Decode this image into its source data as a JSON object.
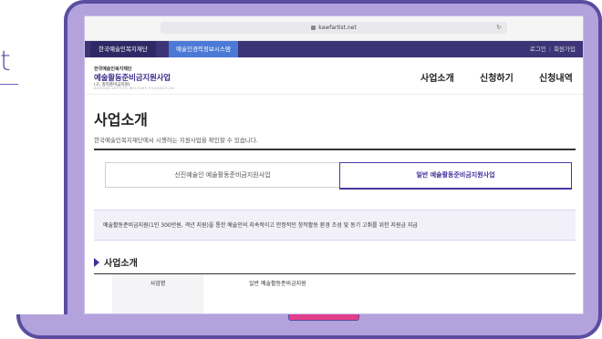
{
  "background": {
    "partial_text": "t"
  },
  "browser": {
    "url": "kawfartist.net"
  },
  "topbar": {
    "tab_foundation": "한국예술인복지재단",
    "tab_system": "예술인경력정보시스템",
    "login": "로그인",
    "separator": "|",
    "signup": "회원가입"
  },
  "header": {
    "logo_small": "한국예술인복지재단",
    "logo_main": "예술활동준비금지원사업",
    "logo_sub": "(구, 창작준비금지원)",
    "logo_en": "KOREAN ARTISTS WELFARE FOUNDATION",
    "nav": [
      "사업소개",
      "신청하기",
      "신청내역"
    ]
  },
  "page": {
    "title": "사업소개",
    "subtitle": "한국예술인복지재단에서 시행하는 지원사업을 확인할 수 있습니다."
  },
  "tabs": [
    "신진예술인 예술활동준비금지원사업",
    "일반 예술활동준비금지원사업"
  ],
  "notice": "예술활동준비금지원(1인 300만원, 격년 지원)을 통한 예술인의 지속적이고 안정적인 창작활동 환경 조성 및 동기 고취를 위한 지원금 지급",
  "section": {
    "title": "사업소개"
  },
  "table": {
    "header": "사업명",
    "value": "일반 예술활동준비금지원"
  },
  "colors": {
    "accent": "#3d3199",
    "frame": "#b3a2dc",
    "frame_border": "#5b4da0",
    "indicator": "#e23d8a",
    "topbar": "#3d3477",
    "topbar_tab": "#4b7ad6"
  }
}
